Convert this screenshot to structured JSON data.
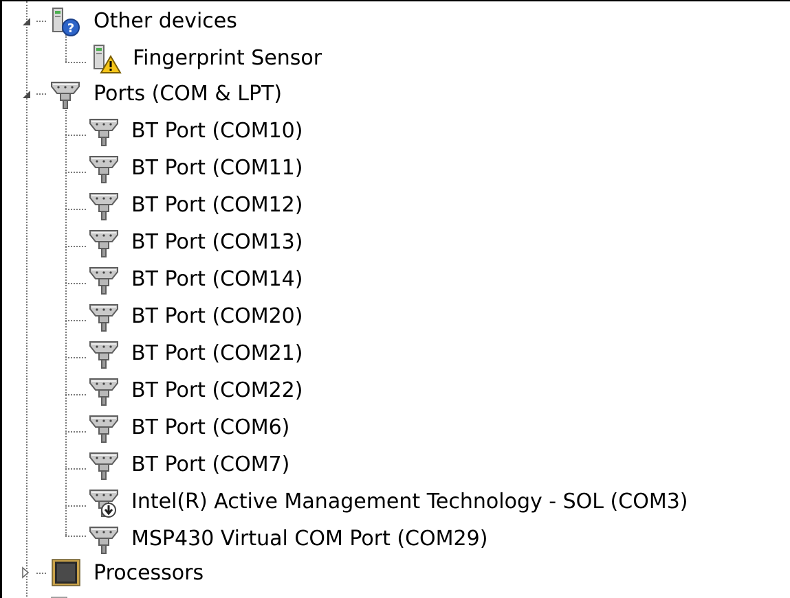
{
  "tree": {
    "other_devices": {
      "label": "Other devices",
      "icon": "unknown-device-icon",
      "children": [
        {
          "label": "Fingerprint Sensor",
          "icon": "warning-device-icon"
        }
      ]
    },
    "ports": {
      "label": "Ports (COM & LPT)",
      "icon": "port-connector-icon",
      "children": [
        {
          "label": "BT Port (COM10)",
          "icon": "port-connector-icon"
        },
        {
          "label": "BT Port (COM11)",
          "icon": "port-connector-icon"
        },
        {
          "label": "BT Port (COM12)",
          "icon": "port-connector-icon"
        },
        {
          "label": "BT Port (COM13)",
          "icon": "port-connector-icon"
        },
        {
          "label": "BT Port (COM14)",
          "icon": "port-connector-icon"
        },
        {
          "label": "BT Port (COM20)",
          "icon": "port-connector-icon"
        },
        {
          "label": "BT Port (COM21)",
          "icon": "port-connector-icon"
        },
        {
          "label": "BT Port (COM22)",
          "icon": "port-connector-icon"
        },
        {
          "label": "BT Port (COM6)",
          "icon": "port-connector-icon"
        },
        {
          "label": "BT Port (COM7)",
          "icon": "port-connector-icon"
        },
        {
          "label": "Intel(R) Active Management Technology - SOL (COM3)",
          "icon": "port-disabled-icon"
        },
        {
          "label": "MSP430 Virtual COM Port (COM29)",
          "icon": "port-connector-icon"
        }
      ]
    },
    "processors": {
      "label": "Processors",
      "icon": "processor-chip-icon",
      "expanded": false
    }
  }
}
